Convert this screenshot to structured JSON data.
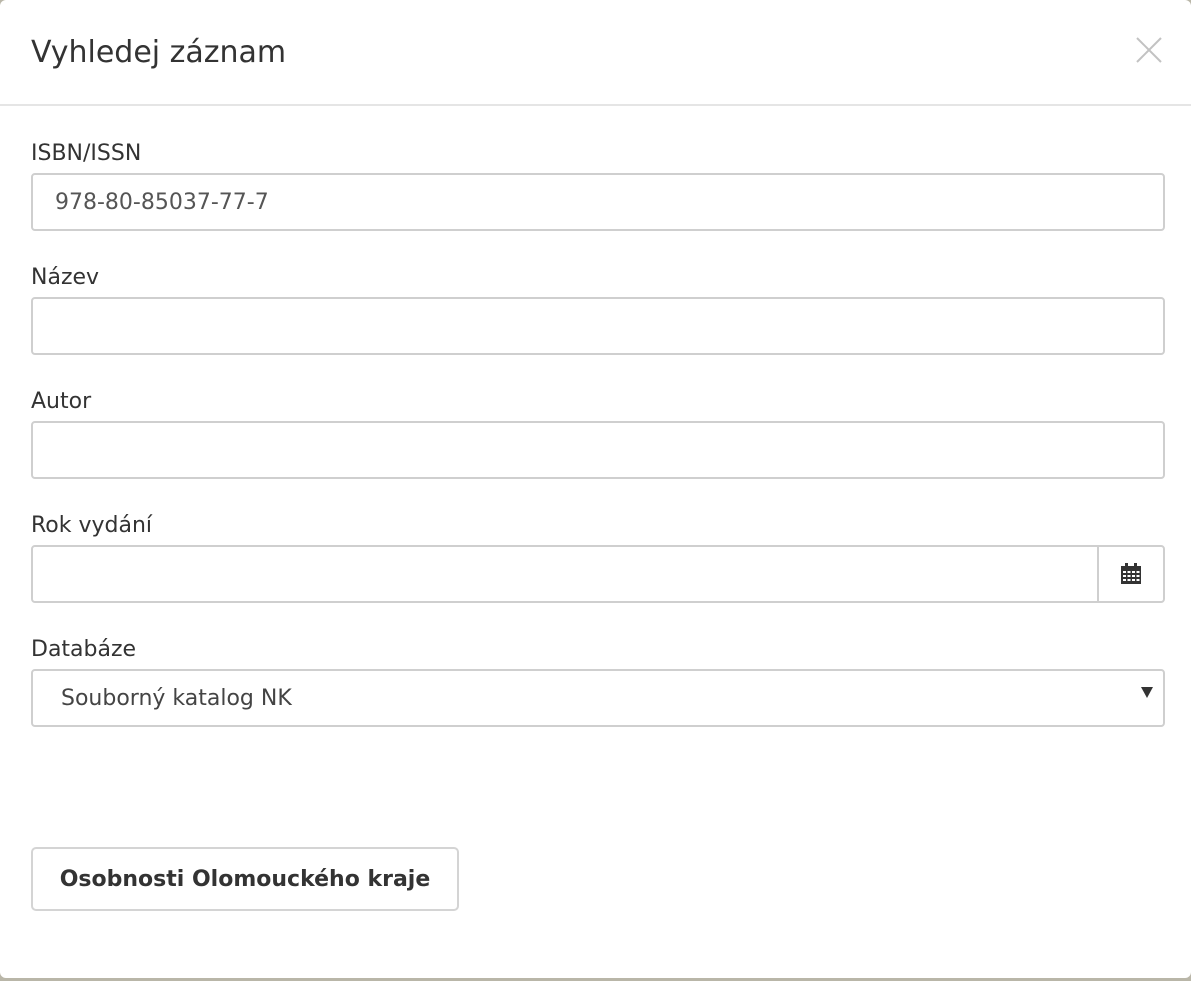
{
  "dialog": {
    "title": "Vyhledej záznam"
  },
  "fields": {
    "isbn": {
      "label": "ISBN/ISSN",
      "value": "978-80-85037-77-7"
    },
    "title": {
      "label": "Název",
      "value": ""
    },
    "author": {
      "label": "Autor",
      "value": ""
    },
    "year": {
      "label": "Rok vydání",
      "value": "",
      "addon_icon": "calendar-icon"
    },
    "database": {
      "label": "Databáze",
      "selected": "Souborný katalog NK"
    }
  },
  "actions": {
    "region_button_label": "Osobnosti Olomouckého kraje"
  },
  "icons": {
    "close": "close-icon",
    "dropdown": "caret-down-icon"
  }
}
